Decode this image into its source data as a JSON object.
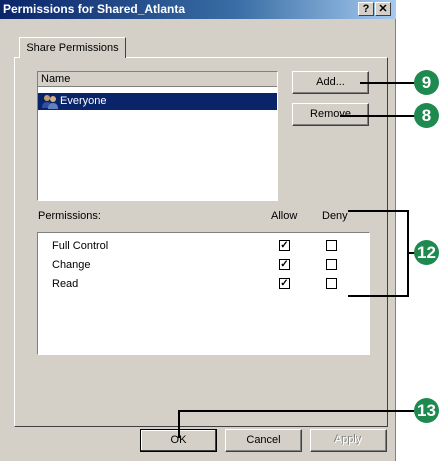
{
  "window": {
    "title": "Permissions for Shared_Atlanta",
    "help_glyph": "?",
    "close_glyph": "✕"
  },
  "tab": {
    "label": "Share Permissions"
  },
  "user_list": {
    "header": "Name",
    "rows": [
      {
        "label": "Everyone",
        "icon": "group-users-icon",
        "selected": true
      }
    ]
  },
  "buttons": {
    "add": "Add...",
    "remove": "Remove",
    "ok": "OK",
    "cancel": "Cancel",
    "apply": "Apply"
  },
  "permissions": {
    "label": "Permissions:",
    "allow_header": "Allow",
    "deny_header": "Deny",
    "rows": [
      {
        "name": "Full Control",
        "allow": true,
        "deny": false
      },
      {
        "name": "Change",
        "allow": true,
        "deny": false
      },
      {
        "name": "Read",
        "allow": true,
        "deny": false
      }
    ]
  },
  "callouts": {
    "add": "9",
    "remove": "8",
    "permissions": "12",
    "ok": "13"
  },
  "colors": {
    "callout": "#1e8a50",
    "titlebar": "#0a246a",
    "selection": "#0a246a",
    "dialog": "#d4d0c8"
  }
}
